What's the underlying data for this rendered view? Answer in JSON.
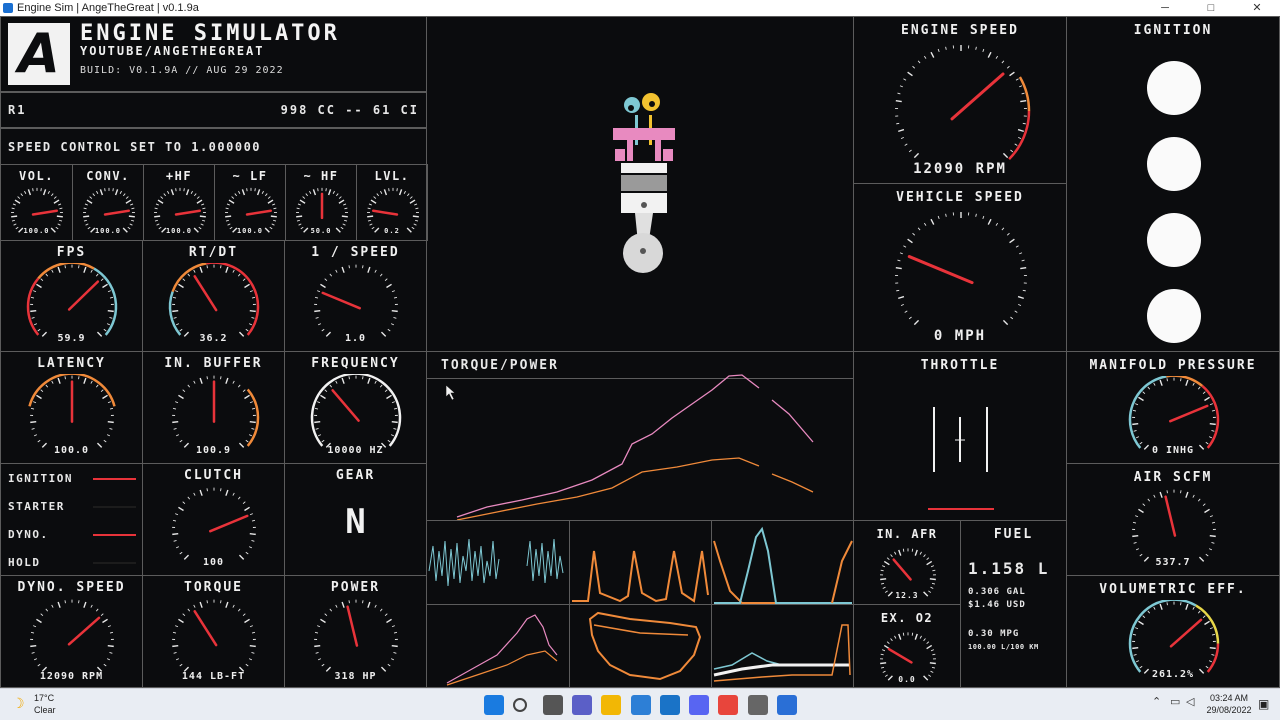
{
  "window": {
    "title": "Engine Sim | AngeTheGreat | v0.1.9a",
    "minimize": "─",
    "maximize": "□",
    "close": "✕"
  },
  "header": {
    "logo": "A",
    "title": "ENGINE SIMULATOR",
    "subtitle": "YOUTUBE/ANGETHEGREAT",
    "build": "BUILD: V0.1.9A // AUG 29 2022"
  },
  "engine_info": {
    "name": "R1",
    "displacement": "998 CC -- 61 CI"
  },
  "speed_control": "SPEED CONTROL SET TO 1.000000",
  "small_gauges": [
    {
      "label": "VOL.",
      "value": "100.0",
      "level": 0.8
    },
    {
      "label": "CONV.",
      "value": "100.0",
      "level": 0.8
    },
    {
      "label": "+HF",
      "value": "100.0",
      "level": 0.8
    },
    {
      "label": "~ LF",
      "value": "100.0",
      "level": 0.8
    },
    {
      "label": "~ HF",
      "value": "50.0",
      "level": 0.5
    },
    {
      "label": "LVL.",
      "value": "0.2",
      "level": 0.2
    }
  ],
  "gauges": {
    "fps": {
      "label": "FPS",
      "value": "59.9",
      "level": 0.67
    },
    "rtdt": {
      "label": "RT/DT",
      "value": "36.2",
      "level": 0.38
    },
    "inv_speed": {
      "label": "1 / SPEED",
      "value": "1.0",
      "level": 0.25
    },
    "latency": {
      "label": "LATENCY",
      "value": "100.0",
      "level": 0.5
    },
    "in_buffer": {
      "label": "IN. BUFFER",
      "value": "100.9",
      "level": 0.5
    },
    "frequency": {
      "label": "FREQUENCY",
      "value": "10000 HZ",
      "level": 0.35
    },
    "engine_speed": {
      "label": "ENGINE SPEED",
      "value": "12090 RPM",
      "level": 0.68
    },
    "vehicle_speed": {
      "label": "VEHICLE SPEED",
      "value": "0 MPH",
      "level": 0.25
    },
    "manifold_pressure": {
      "label": "MANIFOLD PRESSURE",
      "value": "0 INHG",
      "level": 0.75
    },
    "air_scfm": {
      "label": "AIR SCFM",
      "value": "537.7",
      "level": 0.45
    },
    "volumetric_eff": {
      "label": "VOLUMETRIC EFF.",
      "value": "261.2%",
      "level": 0.68
    },
    "clutch": {
      "label": "CLUTCH",
      "value": "100",
      "level": 0.75
    },
    "dyno_speed": {
      "label": "DYNO. SPEED",
      "value": "12090 RPM",
      "level": 0.68
    },
    "torque": {
      "label": "TORQUE",
      "value": "144 LB-FT",
      "level": 0.38
    },
    "power": {
      "label": "POWER",
      "value": "318 HP",
      "level": 0.45
    },
    "in_afr": {
      "label": "IN. AFR",
      "value": "12.3",
      "level": 0.35
    },
    "ex_o2": {
      "label": "EX. O2",
      "value": "0.0",
      "level": 0.28
    }
  },
  "status_list": [
    {
      "label": "IGNITION",
      "active": true
    },
    {
      "label": "STARTER",
      "active": false
    },
    {
      "label": "DYNO.",
      "active": true
    },
    {
      "label": "HOLD",
      "active": false
    }
  ],
  "gear": {
    "label": "GEAR",
    "value": "N"
  },
  "ignition": {
    "label": "IGNITION"
  },
  "throttle": {
    "label": "THROTTLE"
  },
  "torque_power": {
    "label": "TORQUE/POWER"
  },
  "fuel": {
    "label": "FUEL",
    "liters": "1.158 L",
    "gallons": "0.306 GAL",
    "cost": "$1.46 USD",
    "mpg": "0.30 MPG",
    "l100": "100.00 L/100 KM"
  },
  "colors": {
    "red": "#e8333a",
    "orange": "#f08a3a",
    "teal": "#7ec8d3",
    "pink": "#e88ac0",
    "bg": "#0b0c0e",
    "border": "#5c5c5c"
  },
  "taskbar": {
    "weather_temp": "17°C",
    "weather_desc": "Clear",
    "time": "03:24 AM",
    "date": "29/08/2022",
    "icons": [
      "windows-start-icon",
      "search-icon",
      "task-view-icon",
      "teams-icon",
      "file-explorer-icon",
      "store-icon",
      "mail-icon",
      "discord-icon",
      "chrome-icon",
      "settings-icon",
      "engine-sim-icon"
    ]
  }
}
